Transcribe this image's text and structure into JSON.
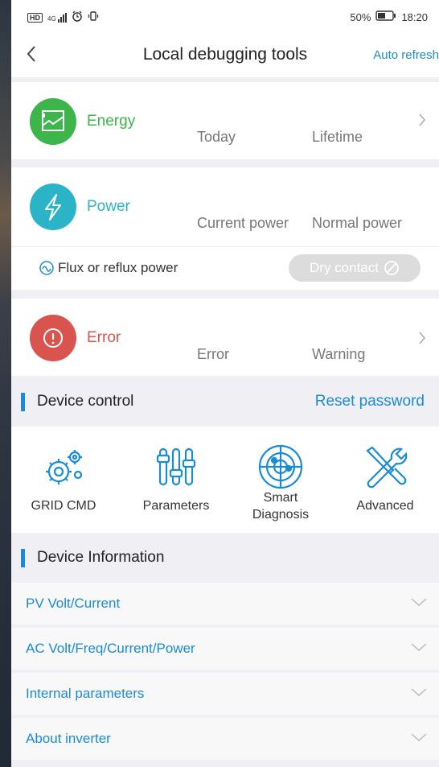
{
  "status_bar": {
    "left_icons": [
      "hd-icon",
      "signal-icon",
      "alarm-icon",
      "vibrate-icon"
    ],
    "network_label": "4G",
    "battery_percent": "50%",
    "time": "18:20"
  },
  "nav": {
    "title": "Local debugging tools",
    "auto_refresh_label": "Auto refresh"
  },
  "energy": {
    "label": "Energy",
    "today_label": "Today",
    "lifetime_label": "Lifetime",
    "color": "#3cb54a"
  },
  "power": {
    "label": "Power",
    "current_label": "Current power",
    "normal_label": "Normal power",
    "flux_label": "Flux or reflux power",
    "dry_contact_label": "Dry contact",
    "color": "#2bb3c8"
  },
  "error": {
    "label": "Error",
    "error_label": "Error",
    "warning_label": "Warning",
    "color": "#d9534f"
  },
  "device_control": {
    "title": "Device control",
    "reset_password_label": "Reset password",
    "items": [
      {
        "label": "GRID CMD",
        "icon": "gears-icon"
      },
      {
        "label": "Parameters",
        "icon": "sliders-icon"
      },
      {
        "label_line1": "Smart",
        "label_line2": "Diagnosis",
        "icon": "radar-icon"
      },
      {
        "label": "Advanced",
        "icon": "tools-icon"
      }
    ]
  },
  "device_information": {
    "title": "Device Information",
    "rows": [
      {
        "label": "PV Volt/Current"
      },
      {
        "label": "AC Volt/Freq/Current/Power"
      },
      {
        "label": "Internal parameters"
      },
      {
        "label": "About inverter"
      }
    ]
  },
  "accent_color": "#1a8bd6"
}
